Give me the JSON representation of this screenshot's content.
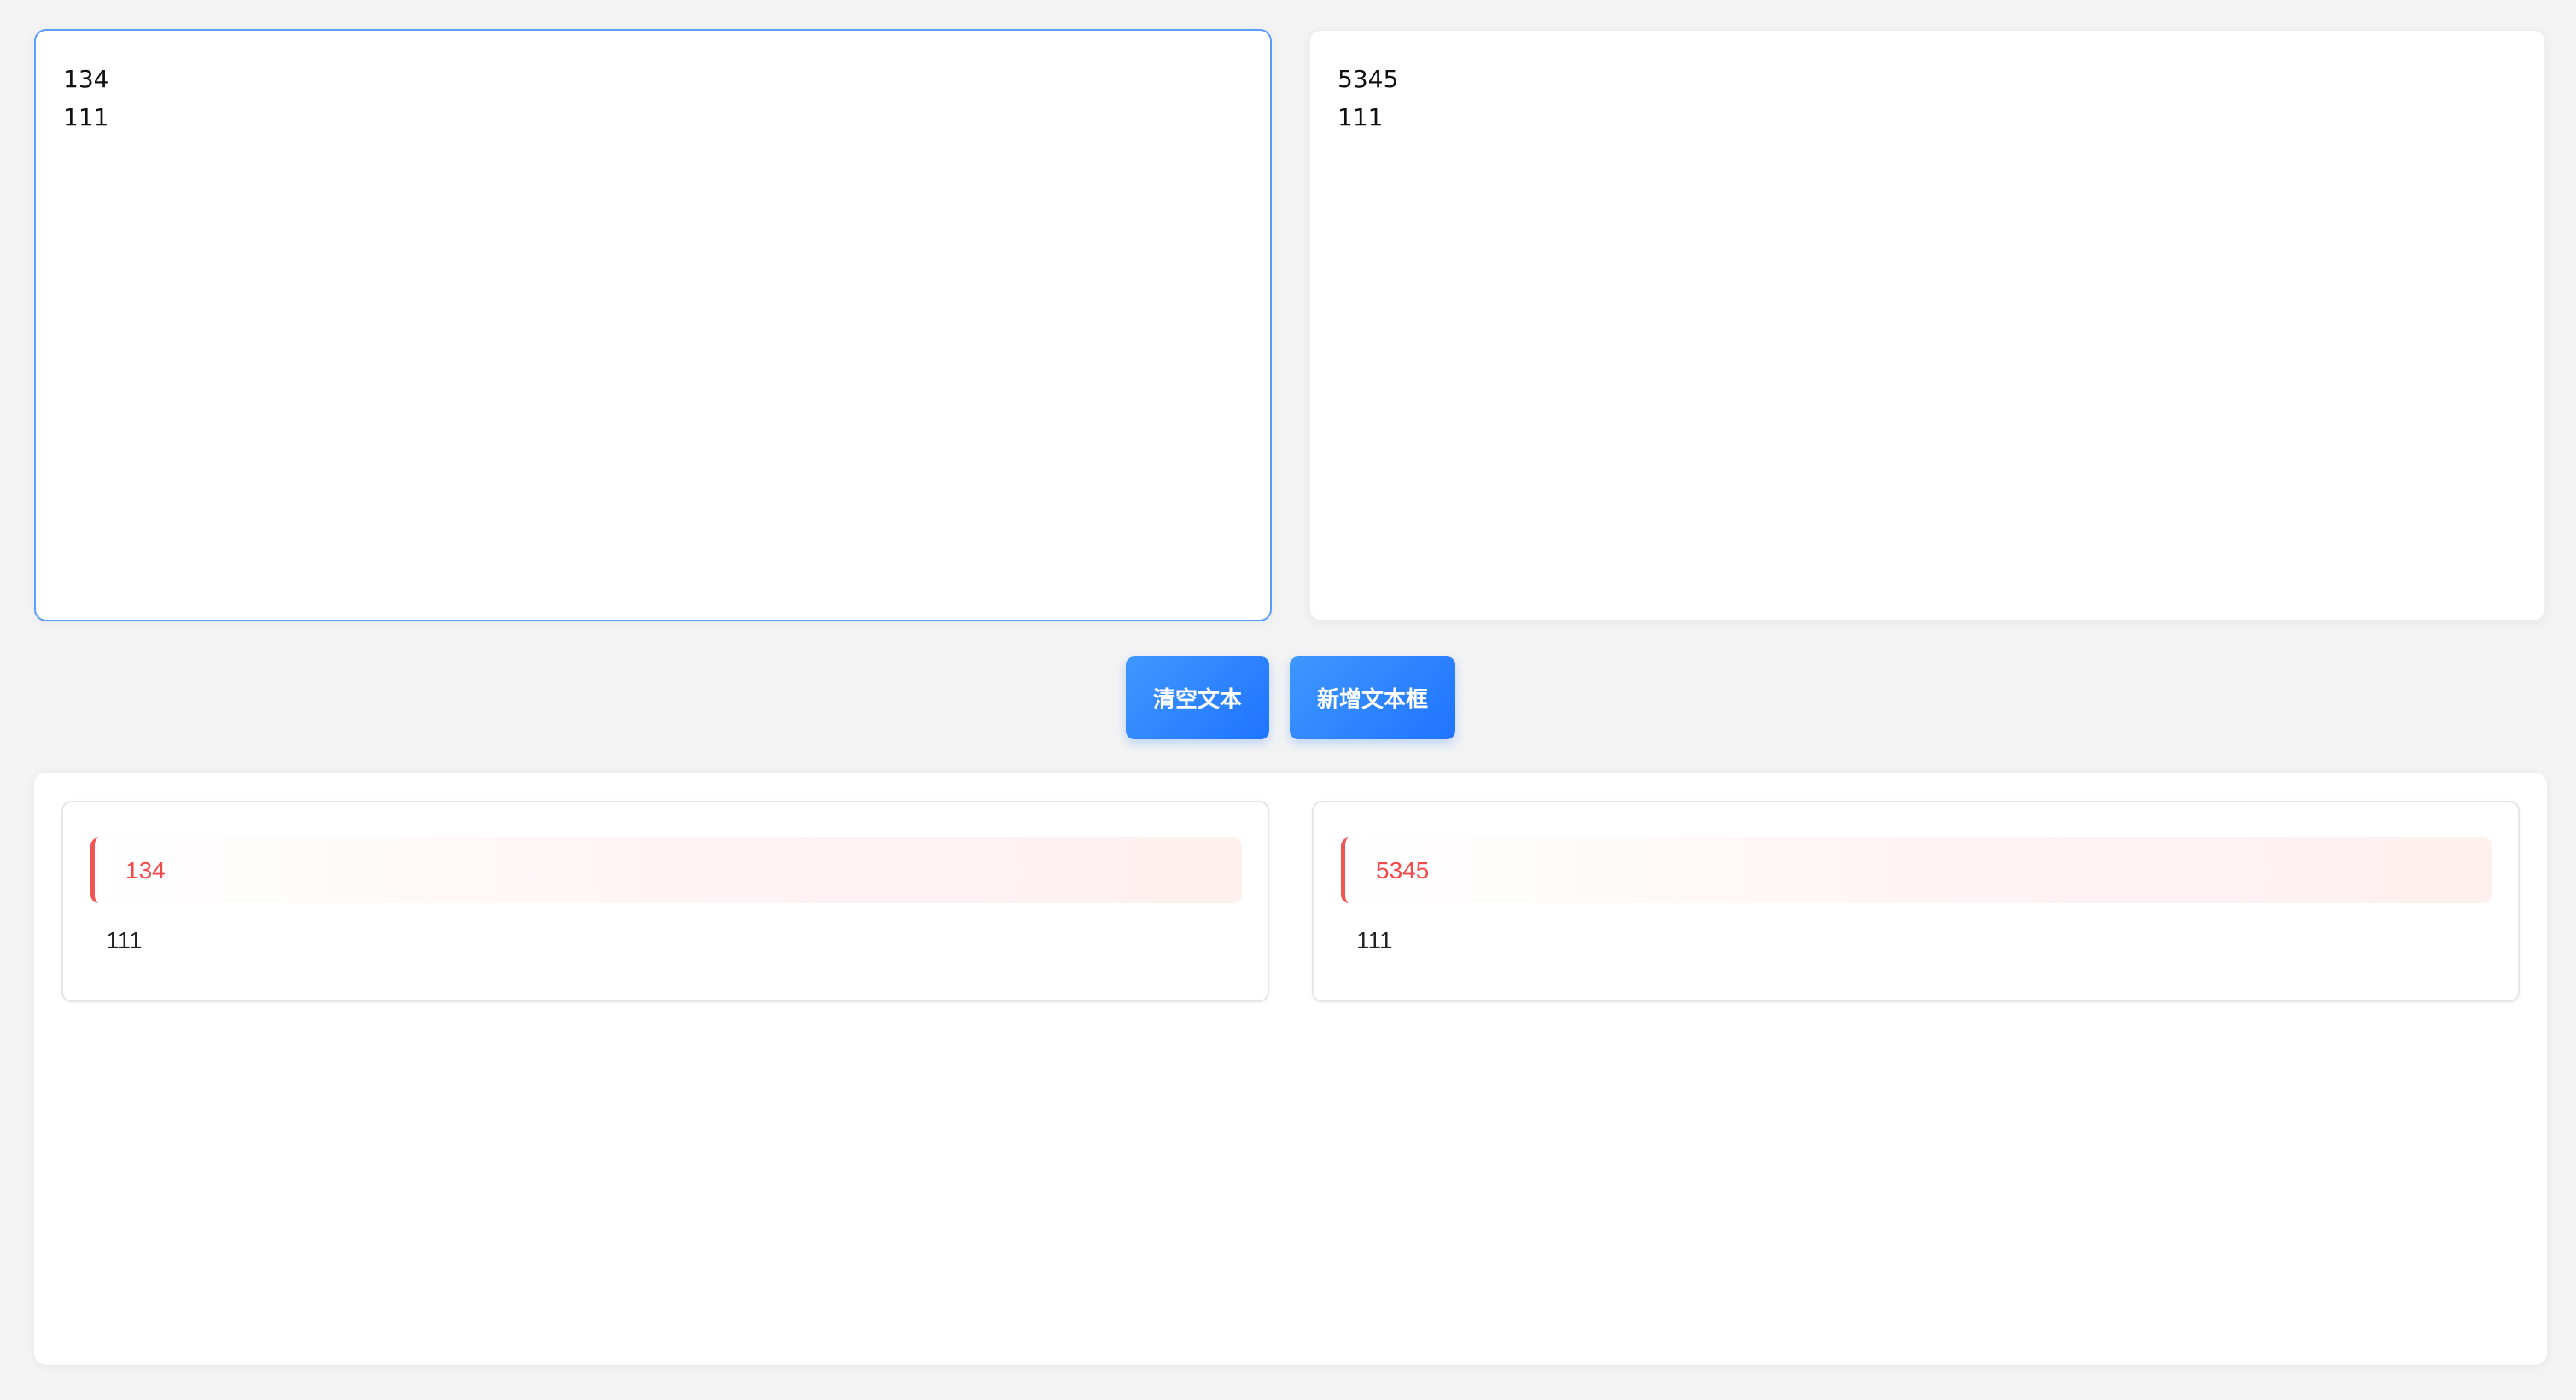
{
  "editors": {
    "left": {
      "value": "134\n111"
    },
    "right": {
      "value": "5345\n111"
    }
  },
  "toolbar": {
    "clear_label": "清空文本",
    "add_label": "新增文本框"
  },
  "results": [
    {
      "changed_line": "134",
      "unchanged_line": "111"
    },
    {
      "changed_line": "5345",
      "unchanged_line": "111"
    }
  ],
  "colors": {
    "accent": "#1f74ff",
    "focus_border": "#5a9cff",
    "diff_text": "#f24a4a",
    "diff_bar": "#f25454",
    "background": "#f3f3f3"
  }
}
